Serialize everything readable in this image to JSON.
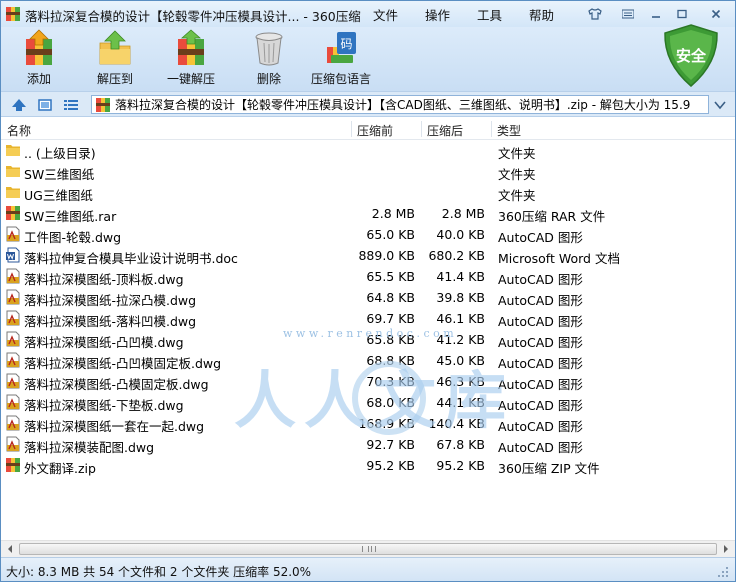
{
  "titlebar": {
    "title": "落料拉深复合模的设计【轮毂零件冲压模具设计... - 360压缩",
    "menus": [
      "文件",
      "操作",
      "工具",
      "帮助"
    ]
  },
  "toolbar": {
    "buttons": [
      {
        "label": "添加",
        "icon": "add-archive-icon"
      },
      {
        "label": "解压到",
        "icon": "extract-to-icon"
      },
      {
        "label": "一键解压",
        "icon": "one-click-extract-icon"
      },
      {
        "label": "删除",
        "icon": "trash-bin-icon"
      },
      {
        "label": "压缩包语言",
        "icon": "archive-language-icon"
      }
    ],
    "language_glyph": "码",
    "security_label": "安全"
  },
  "address": {
    "path": "落料拉深复合模的设计【轮毂零件冲压模具设计】【含CAD图纸、三维图纸、说明书】.zip - 解包大小为 15.9"
  },
  "columns": [
    "名称",
    "压缩前",
    "压缩后",
    "类型"
  ],
  "files": [
    {
      "name": ".. (上级目录)",
      "size": "",
      "packed": "",
      "type": "文件夹",
      "icon": "folder"
    },
    {
      "name": "SW三维图纸",
      "size": "",
      "packed": "",
      "type": "文件夹",
      "icon": "folder"
    },
    {
      "name": "UG三维图纸",
      "size": "",
      "packed": "",
      "type": "文件夹",
      "icon": "folder"
    },
    {
      "name": "SW三维图纸.rar",
      "size": "2.8 MB",
      "packed": "2.8 MB",
      "type": "360压缩 RAR 文件",
      "icon": "archive"
    },
    {
      "name": "工件图-轮毂.dwg",
      "size": "65.0 KB",
      "packed": "40.0 KB",
      "type": "AutoCAD 图形",
      "icon": "dwg"
    },
    {
      "name": "落料拉伸复合模具毕业设计说明书.doc",
      "size": "889.0 KB",
      "packed": "680.2 KB",
      "type": "Microsoft Word 文档",
      "icon": "doc"
    },
    {
      "name": "落料拉深模图纸-顶料板.dwg",
      "size": "65.5 KB",
      "packed": "41.4 KB",
      "type": "AutoCAD 图形",
      "icon": "dwg"
    },
    {
      "name": "落料拉深模图纸-拉深凸模.dwg",
      "size": "64.8 KB",
      "packed": "39.8 KB",
      "type": "AutoCAD 图形",
      "icon": "dwg"
    },
    {
      "name": "落料拉深模图纸-落料凹模.dwg",
      "size": "69.7 KB",
      "packed": "46.1 KB",
      "type": "AutoCAD 图形",
      "icon": "dwg"
    },
    {
      "name": "落料拉深模图纸-凸凹模.dwg",
      "size": "65.8 KB",
      "packed": "41.2 KB",
      "type": "AutoCAD 图形",
      "icon": "dwg"
    },
    {
      "name": "落料拉深模图纸-凸凹模固定板.dwg",
      "size": "68.8 KB",
      "packed": "45.0 KB",
      "type": "AutoCAD 图形",
      "icon": "dwg"
    },
    {
      "name": "落料拉深模图纸-凸模固定板.dwg",
      "size": "70.3 KB",
      "packed": "46.3 KB",
      "type": "AutoCAD 图形",
      "icon": "dwg"
    },
    {
      "name": "落料拉深模图纸-下垫板.dwg",
      "size": "68.0 KB",
      "packed": "44.1 KB",
      "type": "AutoCAD 图形",
      "icon": "dwg"
    },
    {
      "name": "落料拉深模图纸一套在一起.dwg",
      "size": "168.9 KB",
      "packed": "140.4 KB",
      "type": "AutoCAD 图形",
      "icon": "dwg"
    },
    {
      "name": "落料拉深模装配图.dwg",
      "size": "92.7 KB",
      "packed": "67.8 KB",
      "type": "AutoCAD 图形",
      "icon": "dwg"
    },
    {
      "name": "外文翻译.zip",
      "size": "95.2 KB",
      "packed": "95.2 KB",
      "type": "360压缩 ZIP 文件",
      "icon": "archive"
    }
  ],
  "watermark": {
    "text": "人人文库",
    "url": "www.renrendoc.com"
  },
  "status": "大小: 8.3 MB 共 54 个文件和 2 个文件夹 压缩率 52.0%",
  "colors": {
    "accent": "#2f74c0",
    "folder": "#f5c542",
    "shield": "#4aa640"
  }
}
